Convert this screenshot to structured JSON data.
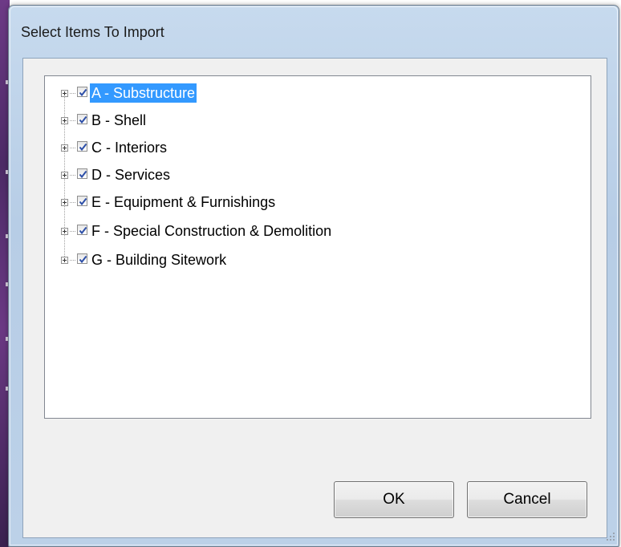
{
  "dialog": {
    "title": "Select Items To Import"
  },
  "tree": {
    "items": [
      {
        "label": "A - Substructure",
        "checked": true,
        "selected": true
      },
      {
        "label": "B - Shell",
        "checked": true,
        "selected": false
      },
      {
        "label": "C - Interiors",
        "checked": true,
        "selected": false
      },
      {
        "label": "D - Services",
        "checked": true,
        "selected": false
      },
      {
        "label": "E - Equipment & Furnishings",
        "checked": true,
        "selected": false
      },
      {
        "label": "F - Special Construction & Demolition",
        "checked": true,
        "selected": false
      },
      {
        "label": "G - Building Sitework",
        "checked": true,
        "selected": false
      }
    ]
  },
  "buttons": {
    "ok_label": "OK",
    "cancel_label": "Cancel"
  },
  "colors": {
    "selection": "#3399ff",
    "checkmark": "#2d4fa8",
    "frame": "#bcd1e8"
  }
}
